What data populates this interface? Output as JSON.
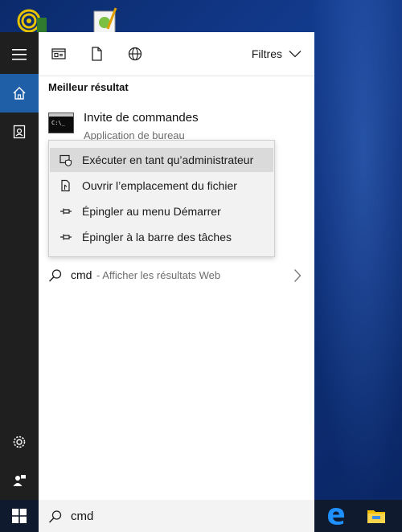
{
  "toolbar": {
    "filters_label": "Filtres"
  },
  "results": {
    "section_title": "Meilleur résultat",
    "best": {
      "name": "Invite de commandes",
      "type": "Application de bureau",
      "icon_prompt": "C:\\_"
    }
  },
  "context_menu": {
    "items": [
      {
        "label": "Exécuter en tant qu’administrateur",
        "icon": "admin-shield-icon"
      },
      {
        "label": "Ouvrir l’emplacement du fichier",
        "icon": "file-location-icon"
      },
      {
        "label": "Épingler au menu Démarrer",
        "icon": "pin-icon"
      },
      {
        "label": "Épingler à la barre des tâches",
        "icon": "pin-icon"
      }
    ]
  },
  "web": {
    "query": "cmd",
    "suffix": "- Afficher les résultats Web"
  },
  "search": {
    "value": "cmd"
  },
  "colors": {
    "accent": "#1e5fa8",
    "rail": "#1f1f1f",
    "taskbar": "#101a2e"
  }
}
